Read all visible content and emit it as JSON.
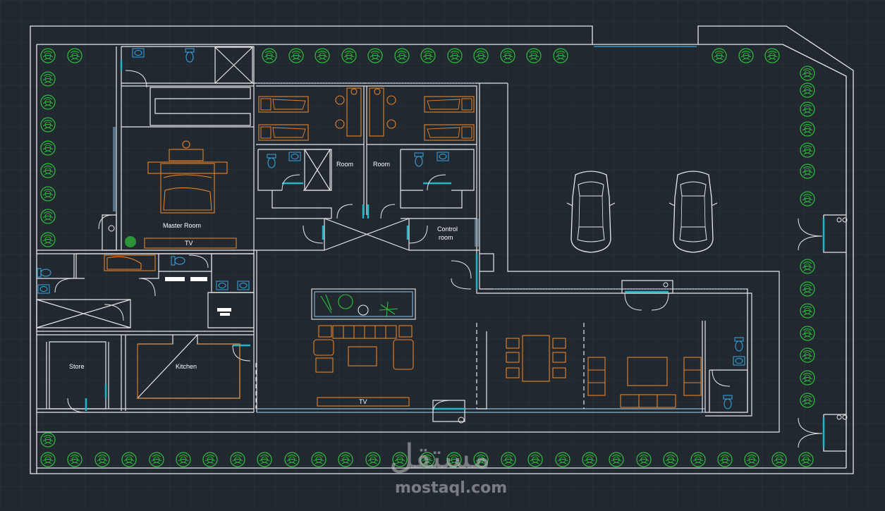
{
  "plan": {
    "rooms": {
      "master_room": "Master Room",
      "room_left": "Room",
      "room_right": "Room",
      "control_room_line1": "Control",
      "control_room_line2": "room",
      "store": "Store",
      "kitchen": "Kitchen"
    },
    "tv_labels": {
      "master": "TV",
      "living": "TV"
    }
  },
  "watermark": {
    "arabic": "مستقل",
    "latin": "mostaql.com"
  },
  "colors": {
    "background": "#212830",
    "grid": "#2a323b",
    "walls": "#e8e8e8",
    "furniture": "#e8822a",
    "fixtures": "#36a8e6",
    "plants": "#2fc23a",
    "glass": "#8fb8d8",
    "doors": "#1fb5c9"
  },
  "icons": [
    "tree-icon",
    "car-icon",
    "bed-icon",
    "sofa-icon",
    "toilet-icon",
    "sink-icon",
    "door-swing-icon"
  ]
}
